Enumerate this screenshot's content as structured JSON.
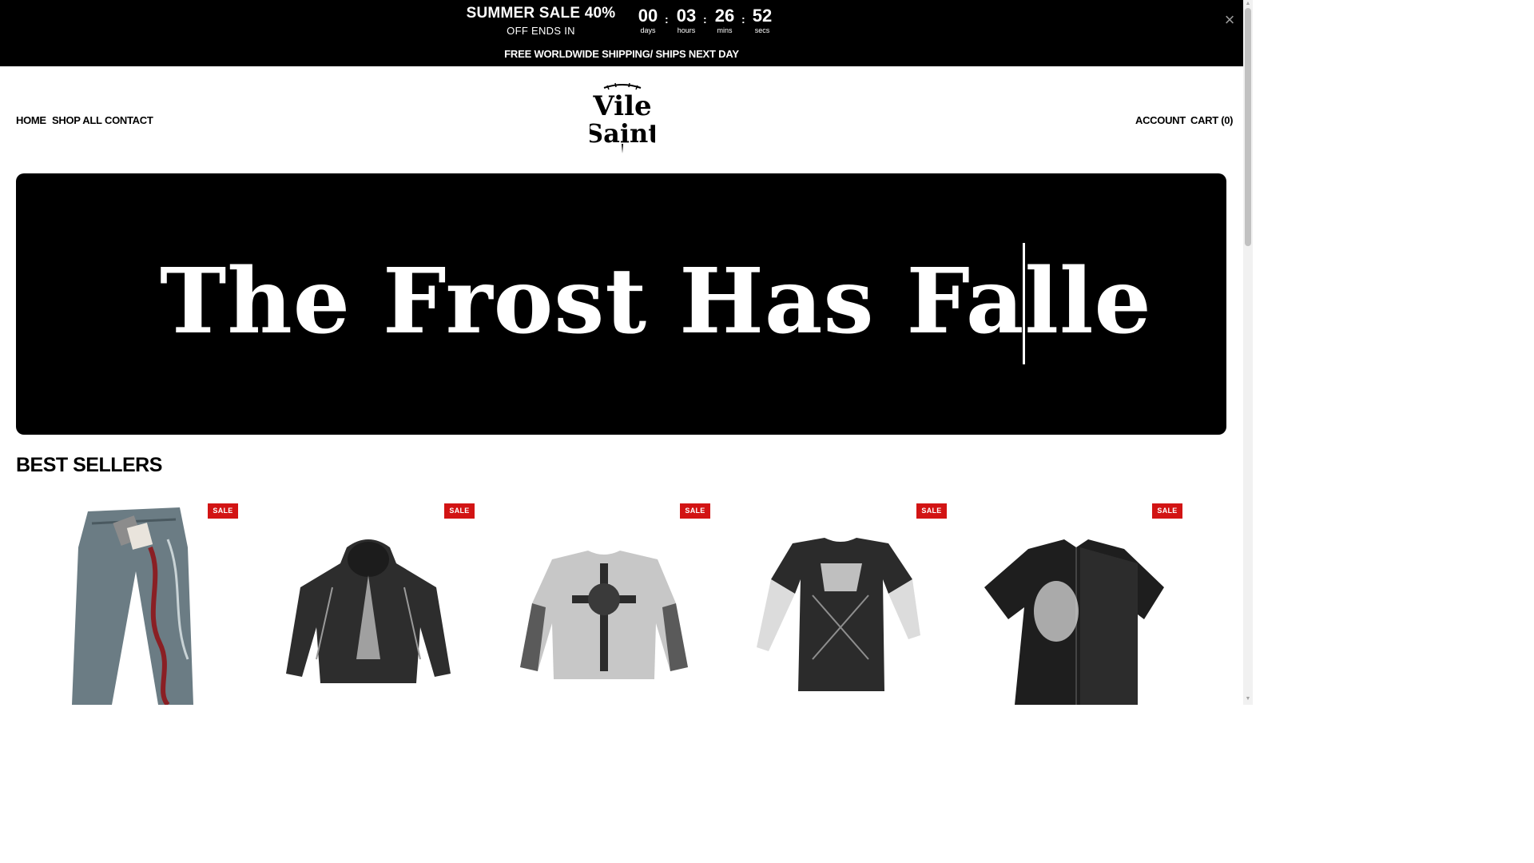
{
  "announcement": {
    "promo_title": "SUMMER SALE 40%",
    "promo_sub": "OFF ENDS IN",
    "countdown": [
      {
        "value": "00",
        "label": "days"
      },
      {
        "value": "03",
        "label": "hours"
      },
      {
        "value": "26",
        "label": "mins"
      },
      {
        "value": "52",
        "label": "secs"
      }
    ],
    "separator": ":",
    "close_icon": "close-icon",
    "shipping": "FREE WORLDWIDE SHIPPING/ SHIPS NEXT DAY"
  },
  "header": {
    "nav_left": [
      "HOME",
      "SHOP ALL",
      "CONTACT"
    ],
    "logo_text": [
      "Vile",
      "Saint"
    ],
    "account": "ACCOUNT",
    "cart": "CART (0)"
  },
  "hero": {
    "text": "The Frost Has Falle"
  },
  "best_sellers": {
    "title": "BEST SELLERS",
    "products": [
      {
        "badge": "SALE",
        "image": "baggy-jeans-embroidered"
      },
      {
        "badge": "SALE",
        "image": "black-hoodie-angel-graphic"
      },
      {
        "badge": "SALE",
        "image": "grey-layered-tee-cross-graphic"
      },
      {
        "badge": "SALE",
        "image": "black-layered-longsleeve-graphic"
      },
      {
        "badge": "SALE",
        "image": "black-button-shirt-graphic"
      }
    ]
  },
  "colors": {
    "sale_badge": "#d21414",
    "bar": "#000000"
  }
}
